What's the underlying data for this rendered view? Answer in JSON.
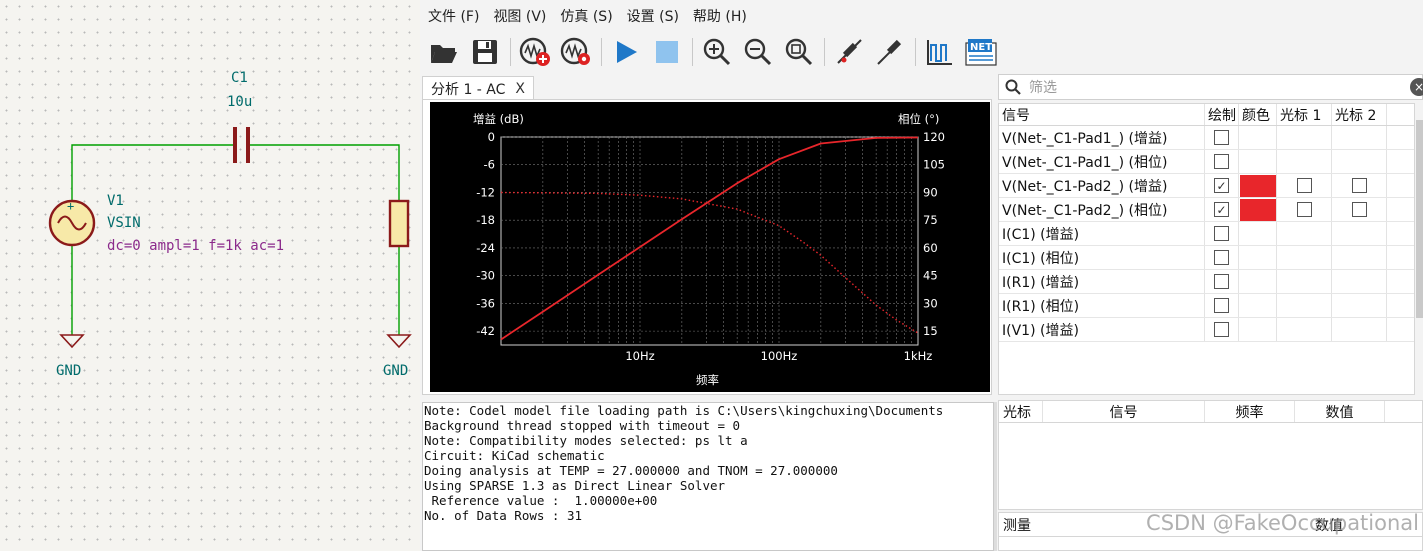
{
  "schematic": {
    "capacitor": {
      "ref": "C1",
      "value": "10u"
    },
    "source": {
      "ref": "V1",
      "value": "VSIN",
      "params": "dc=0 ampl=1 f=1k ac=1",
      "polarity": "+"
    },
    "gnd_left": "GND",
    "gnd_right": "GND"
  },
  "menu": [
    "文件 (F)",
    "视图 (V)",
    "仿真 (S)",
    "设置 (S)",
    "帮助 (H)"
  ],
  "toolbar": {
    "net_badge": "NET"
  },
  "plot_tab": {
    "label": "分析 1 - AC",
    "close": "X"
  },
  "chart_data": {
    "type": "line",
    "title": "",
    "xlabel": "频率",
    "ylabel_left": "增益 (dB)",
    "ylabel_right": "相位 (°)",
    "x_scale": "log",
    "xlim": [
      1,
      1000
    ],
    "ylim_left": [
      -45,
      0
    ],
    "ylim_right": [
      7.5,
      120
    ],
    "x_ticks": [
      {
        "value": 10,
        "label": "10Hz"
      },
      {
        "value": 100,
        "label": "100Hz"
      },
      {
        "value": 1000,
        "label": "1kHz"
      }
    ],
    "y_ticks_left": [
      0,
      -6,
      -12,
      -18,
      -24,
      -30,
      -36,
      -42
    ],
    "y_ticks_right": [
      120,
      105,
      90,
      75,
      60,
      45,
      30,
      15
    ],
    "background": "#000000",
    "grid": true,
    "series": [
      {
        "axis": "left",
        "style": "solid",
        "color": "#e8262b",
        "x": [
          1,
          2,
          5,
          10,
          20,
          50,
          100,
          200,
          500,
          1000
        ],
        "values": [
          -43.8,
          -37.8,
          -29.8,
          -23.8,
          -17.8,
          -10.0,
          -4.8,
          -1.4,
          -0.2,
          -0.1
        ]
      },
      {
        "axis": "right",
        "style": "dotted",
        "color": "#e8262b",
        "x": [
          1,
          2,
          5,
          10,
          20,
          50,
          100,
          150,
          200,
          300,
          500,
          700,
          1000
        ],
        "values": [
          90,
          89.8,
          89.5,
          88.5,
          86.5,
          81,
          72,
          63,
          56,
          44,
          29,
          21,
          14
        ]
      }
    ]
  },
  "console_lines": [
    "Note: Codel model file loading path is C:\\Users\\kingchuxing\\Documents",
    "Background thread stopped with timeout = 0",
    "Note: Compatibility modes selected: ps lt a",
    "Circuit: KiCad schematic",
    "Doing analysis at TEMP = 27.000000 and TNOM = 27.000000",
    "Using SPARSE 1.3 as Direct Linear Solver",
    " Reference value :  1.00000e+00",
    "No. of Data Rows : 31"
  ],
  "filter": {
    "placeholder": "筛选",
    "clear": "×"
  },
  "signals": {
    "headers": [
      "信号",
      "绘制",
      "颜色",
      "光标 1",
      "光标 2"
    ],
    "rows": [
      {
        "name": "V(Net-_C1-Pad1_) (增益)",
        "plot": false,
        "color": null
      },
      {
        "name": "V(Net-_C1-Pad1_) (相位)",
        "plot": false,
        "color": null
      },
      {
        "name": "V(Net-_C1-Pad2_) (增益)",
        "plot": true,
        "color": "#e8262b"
      },
      {
        "name": "V(Net-_C1-Pad2_) (相位)",
        "plot": true,
        "color": "#e8262b"
      },
      {
        "name": "I(C1) (增益)",
        "plot": false,
        "color": null
      },
      {
        "name": "I(C1) (相位)",
        "plot": false,
        "color": null
      },
      {
        "name": "I(R1) (增益)",
        "plot": false,
        "color": null
      },
      {
        "name": "I(R1) (相位)",
        "plot": false,
        "color": null
      },
      {
        "name": "I(V1) (增益)",
        "plot": false,
        "color": null
      }
    ]
  },
  "cursors": {
    "headers": [
      "光标",
      "信号",
      "频率",
      "数值"
    ]
  },
  "measurements": {
    "headers": [
      "测量",
      "数值"
    ]
  },
  "watermark": "CSDN @FakeOccupational"
}
